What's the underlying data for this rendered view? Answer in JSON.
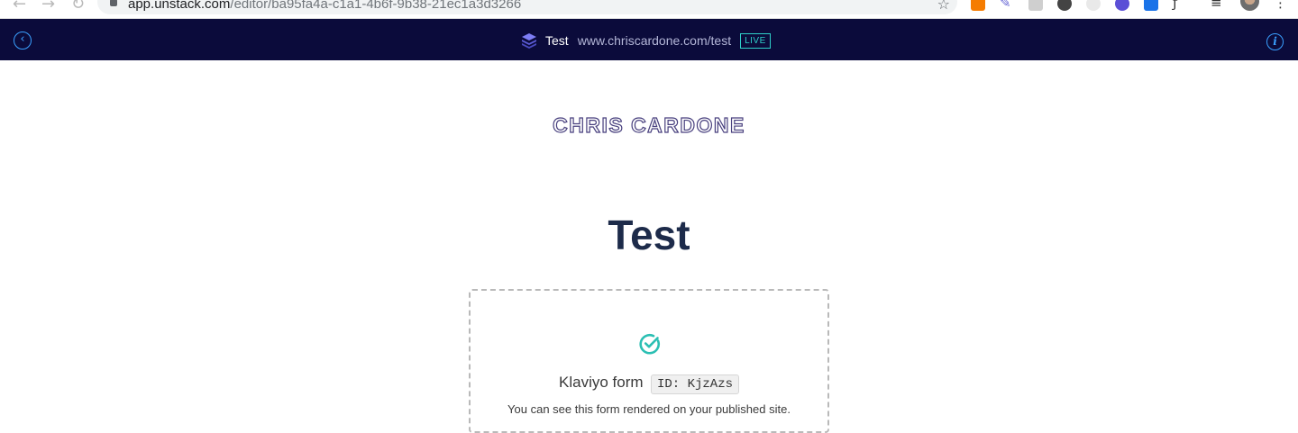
{
  "browser": {
    "url_host": "app.unstack.com",
    "url_path": "/editor/ba95fa4a-c1a1-4b6f-9b38-21ec1a3d3266"
  },
  "topbar": {
    "back_icon": "chevron-left-icon",
    "page_icon": "layers-icon",
    "page_name": "Test",
    "page_url": "www.chriscardone.com/test",
    "status_badge": "LIVE",
    "info_icon": "info-icon",
    "colors": {
      "background": "#0b0b3b",
      "accent": "#3aa0ff",
      "live": "#2fd0c9"
    }
  },
  "page": {
    "logo_text": "CHRIS CARDONE",
    "headline": "Test",
    "form_placeholder": {
      "icon": "check-circle-icon",
      "label": "Klaviyo form",
      "id_text": "ID: KjzAzs",
      "note": "You can see this form rendered on your published site."
    }
  }
}
